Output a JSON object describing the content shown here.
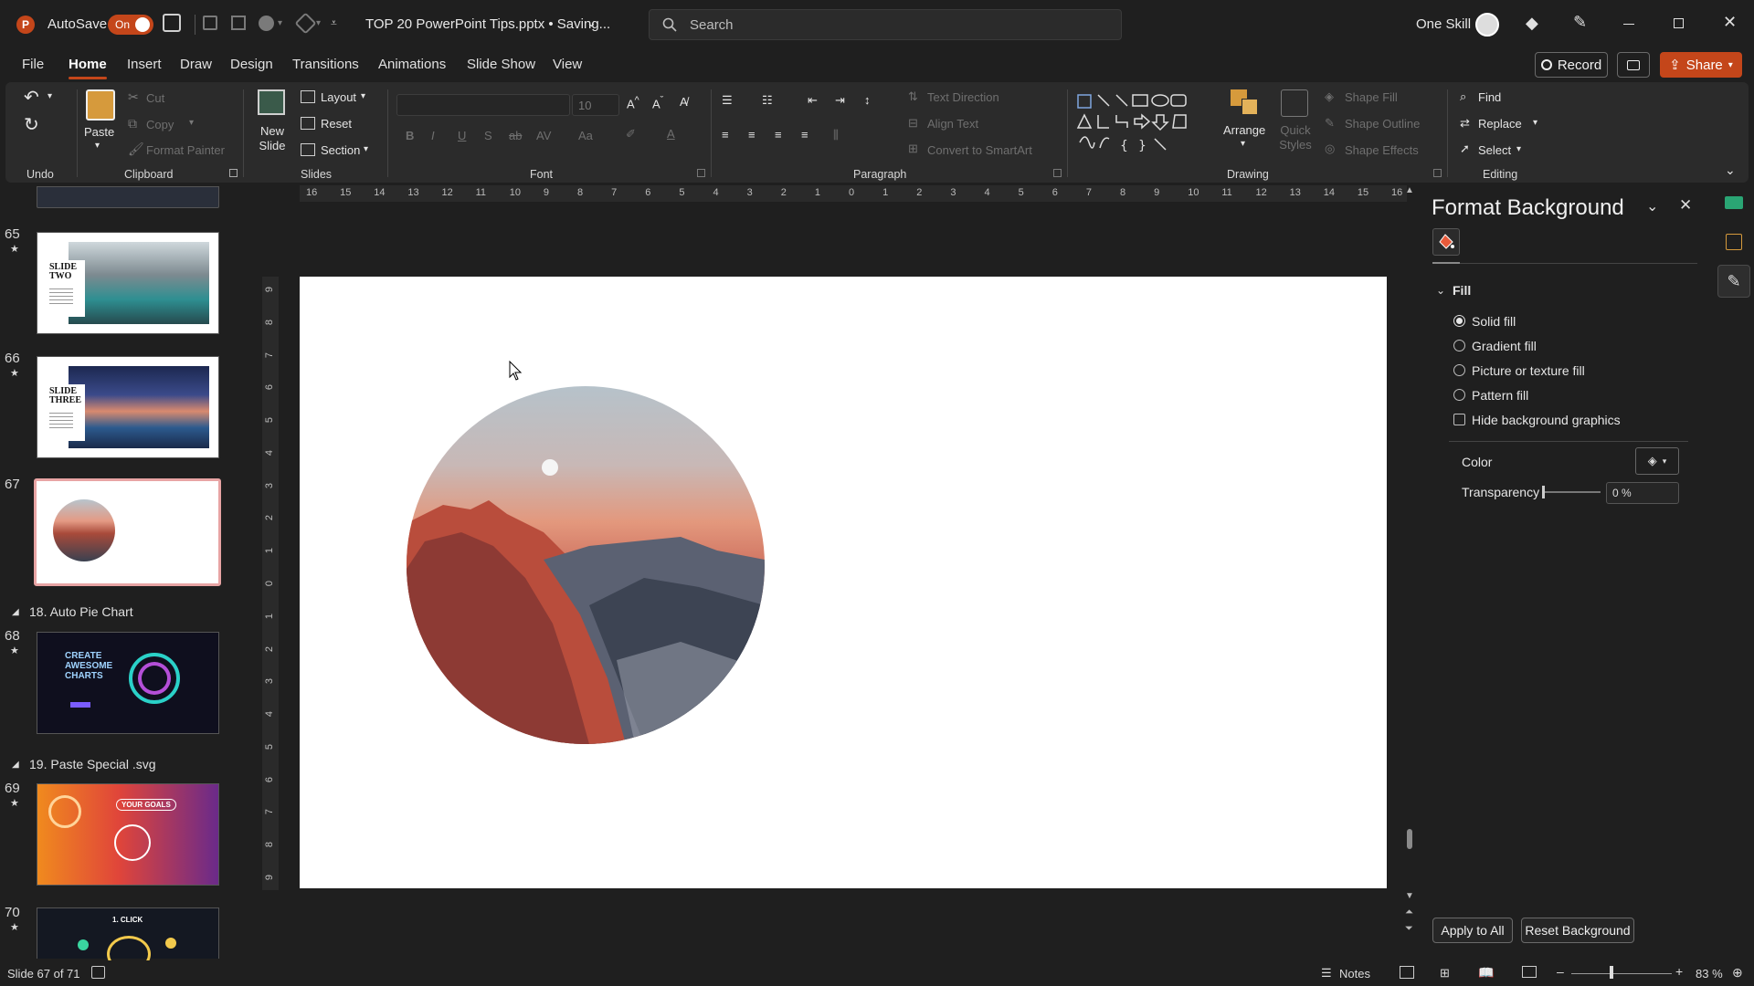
{
  "titlebar": {
    "autosave_label": "AutoSave",
    "autosave_state": "On",
    "document_title": "TOP 20 PowerPoint Tips.pptx • Saving...",
    "search_placeholder": "Search",
    "user_name": "One Skill"
  },
  "menu": {
    "tabs": [
      "File",
      "Home",
      "Insert",
      "Draw",
      "Design",
      "Transitions",
      "Animations",
      "Slide Show",
      "View"
    ],
    "active": "Home",
    "record_label": "Record",
    "share_label": "Share"
  },
  "ribbon": {
    "undo_group": "Undo",
    "clipboard": {
      "label": "Clipboard",
      "paste": "Paste",
      "cut": "Cut",
      "copy": "Copy",
      "format_painter": "Format Painter"
    },
    "slides": {
      "label": "Slides",
      "new_slide": "New Slide",
      "layout": "Layout",
      "reset": "Reset",
      "section": "Section"
    },
    "font": {
      "label": "Font",
      "size": "10"
    },
    "paragraph": {
      "label": "Paragraph",
      "text_direction": "Text Direction",
      "align_text": "Align Text",
      "convert_smartart": "Convert to SmartArt"
    },
    "drawing": {
      "label": "Drawing",
      "arrange": "Arrange",
      "quick_styles": "Quick Styles",
      "shape_fill": "Shape Fill",
      "shape_outline": "Shape Outline",
      "shape_effects": "Shape Effects"
    },
    "editing": {
      "label": "Editing",
      "find": "Find",
      "replace": "Replace",
      "select": "Select"
    }
  },
  "thumbnails": {
    "items": [
      {
        "num": "65",
        "title": "SLIDE TWO"
      },
      {
        "num": "66",
        "title": "SLIDE THREE"
      },
      {
        "num": "67",
        "title": ""
      },
      {
        "num": "68",
        "title": "CREATE AWESOME CHARTS"
      },
      {
        "num": "69",
        "title": "YOUR GOALS"
      },
      {
        "num": "70",
        "title": "1. CLICK"
      }
    ],
    "sections": [
      "18. Auto Pie Chart",
      "19. Paste Special .svg"
    ]
  },
  "ruler": {
    "h_ticks": [
      "16",
      "15",
      "14",
      "13",
      "12",
      "11",
      "10",
      "9",
      "8",
      "7",
      "6",
      "5",
      "4",
      "3",
      "2",
      "1",
      "0",
      "1",
      "2",
      "3",
      "4",
      "5",
      "6",
      "7",
      "8",
      "9",
      "10",
      "11",
      "12",
      "13",
      "14",
      "15",
      "16"
    ],
    "v_ticks": [
      "9",
      "8",
      "7",
      "6",
      "5",
      "4",
      "3",
      "2",
      "1",
      "0",
      "1",
      "2",
      "3",
      "4",
      "5",
      "6",
      "7",
      "8",
      "9"
    ]
  },
  "format_pane": {
    "title": "Format Background",
    "section": "Fill",
    "options": [
      "Solid fill",
      "Gradient fill",
      "Picture or texture fill",
      "Pattern fill"
    ],
    "selected_option": 0,
    "hide_graphics": "Hide background graphics",
    "color_label": "Color",
    "transparency_label": "Transparency",
    "transparency_value": "0 %",
    "apply_all": "Apply to All",
    "reset_background": "Reset Background"
  },
  "statusbar": {
    "slide_info": "Slide 67 of 71",
    "notes": "Notes",
    "zoom": "83 %"
  },
  "colors": {
    "accent": "#c4461a",
    "ribbon_bg": "#2b2b2b",
    "app_bg": "#1f1f1f"
  }
}
